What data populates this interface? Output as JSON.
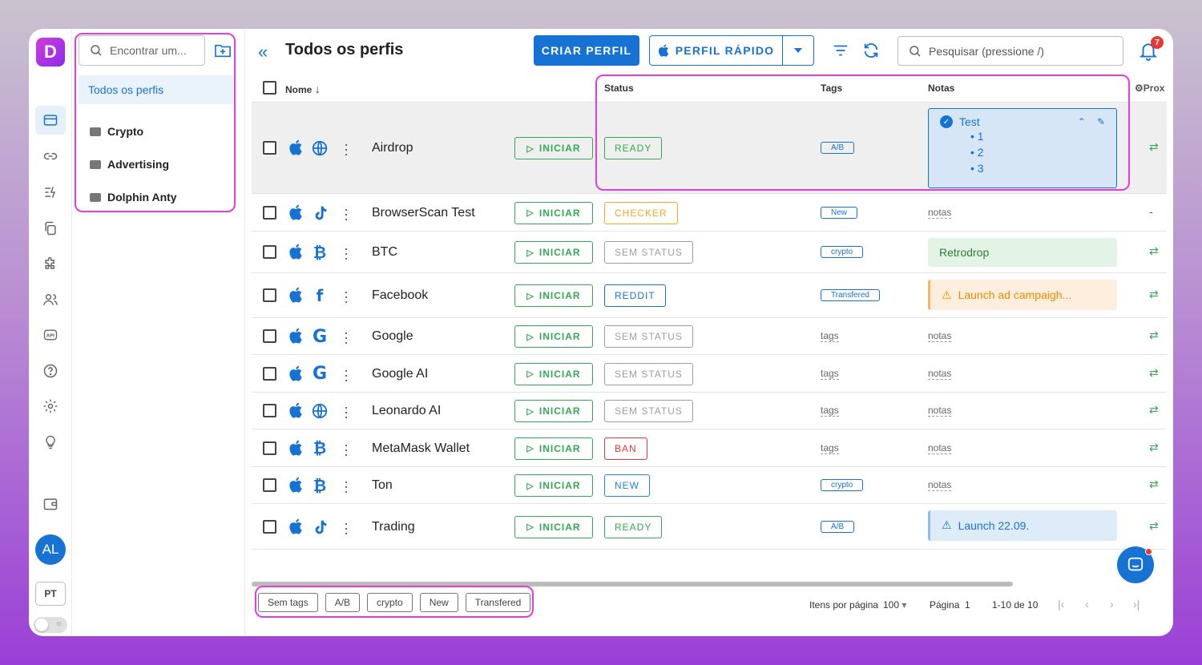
{
  "app": {
    "logo_letter": "D",
    "accent": "#1673d4",
    "highlight": "#e63be0"
  },
  "rail": {
    "items": [
      "profiles-icon",
      "link-icon",
      "automation-icon",
      "copy-icon",
      "extension-icon",
      "users-icon",
      "api-icon",
      "help-icon",
      "settings-icon",
      "idea-icon",
      "wallet-icon"
    ],
    "api_label": "API",
    "avatar": "AL",
    "lang": "PT"
  },
  "folders": {
    "search_placeholder": "Encontrar um...",
    "all_label": "Todos os perfis",
    "items": [
      "Crypto",
      "Advertising",
      "Dolphin Anty"
    ]
  },
  "header": {
    "title": "Todos os perfis",
    "create_label": "CRIAR PERFIL",
    "quick_label": "PERFIL RÁPIDO",
    "search_placeholder": "Pesquisar (pressione /)",
    "notifications_count": "7"
  },
  "table": {
    "columns": {
      "name": "Nome",
      "status": "Status",
      "tags": "Tags",
      "notes": "Notas",
      "proxy": "Prox"
    },
    "start_label": "INICIAR",
    "tags_placeholder": "tags",
    "notes_placeholder": "notas",
    "rows": [
      {
        "name": "Airdrop",
        "site": "globe-icon",
        "status": "READY",
        "status_color": "#34a853",
        "tag": "A/B",
        "note": "Test",
        "note_items": [
          "1",
          "2",
          "3"
        ],
        "proxy": "⇄"
      },
      {
        "name": "BrowserScan Test",
        "site": "tiktok-icon",
        "status": "CHECKER",
        "status_color": "#f5a623",
        "tag": "New",
        "note": "",
        "proxy": "-"
      },
      {
        "name": "BTC",
        "site": "bitcoin-icon",
        "status": "SEM STATUS",
        "status_color": "#9e9e9e",
        "tag": "crypto",
        "note": "Retrodrop",
        "proxy": "⇄"
      },
      {
        "name": "Facebook",
        "site": "facebook-icon",
        "status": "REDDIT",
        "status_color": "#1673d4",
        "tag": "Transfered",
        "note": "Launch ad campaigh...",
        "proxy": "⇄"
      },
      {
        "name": "Google",
        "site": "google-icon",
        "status": "SEM STATUS",
        "status_color": "#9e9e9e",
        "tag": "",
        "note": "",
        "proxy": "⇄"
      },
      {
        "name": "Google AI",
        "site": "google-icon",
        "status": "SEM STATUS",
        "status_color": "#9e9e9e",
        "tag": "",
        "note": "",
        "proxy": "⇄"
      },
      {
        "name": "Leonardo AI",
        "site": "globe-icon",
        "status": "SEM STATUS",
        "status_color": "#9e9e9e",
        "tag": "",
        "note": "",
        "proxy": "⇄"
      },
      {
        "name": "MetaMask Wallet",
        "site": "bitcoin-icon",
        "status": "BAN",
        "status_color": "#e53935",
        "tag": "",
        "note": "",
        "proxy": "⇄"
      },
      {
        "name": "Ton",
        "site": "bitcoin-icon",
        "status": "NEW",
        "status_color": "#1e88e5",
        "tag": "crypto",
        "note": "",
        "proxy": "⇄"
      },
      {
        "name": "Trading",
        "site": "tiktok-icon",
        "status": "READY",
        "status_color": "#34a853",
        "tag": "A/B",
        "note": "Launch 22.09.",
        "proxy": "⇄"
      }
    ]
  },
  "footer": {
    "tags": [
      "Sem tags",
      "A/B",
      "crypto",
      "New",
      "Transfered"
    ],
    "per_page_label": "Itens por página",
    "per_page_value": "100",
    "page_label": "Página",
    "page_value": "1",
    "range": "1-10 de 10"
  }
}
